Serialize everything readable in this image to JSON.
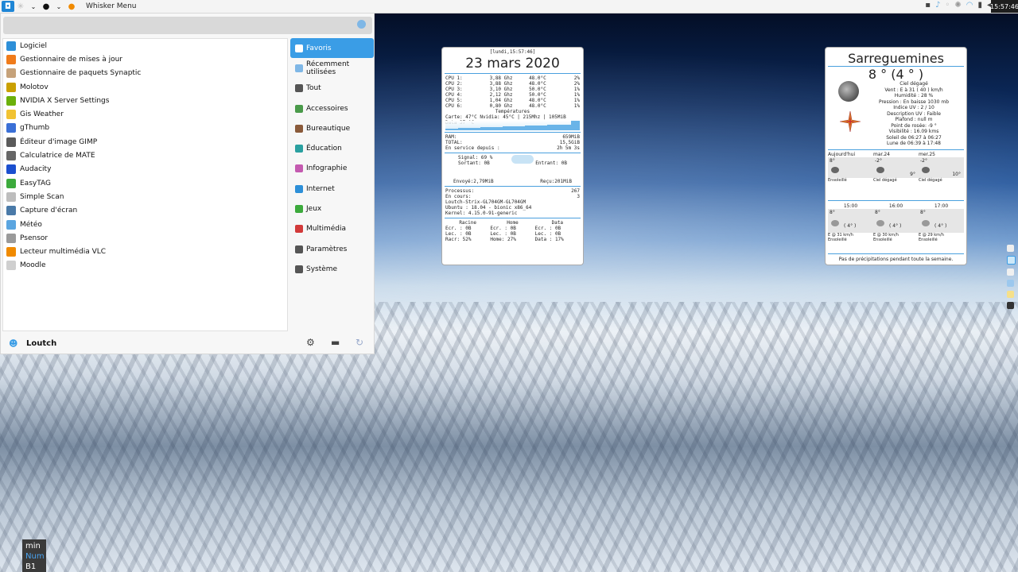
{
  "panel": {
    "menu_title": "Whisker Menu",
    "clock": "15:57:46"
  },
  "search": {
    "placeholder": ""
  },
  "apps": [
    {
      "label": "Logiciel",
      "color": "#2d8fd8"
    },
    {
      "label": "Gestionnaire de mises à jour",
      "color": "#f07b1a"
    },
    {
      "label": "Gestionnaire de paquets Synaptic",
      "color": "#c6a27a"
    },
    {
      "label": "Molotov",
      "color": "#caa000"
    },
    {
      "label": "NVIDIA X Server Settings",
      "color": "#6bb00a"
    },
    {
      "label": "Gis Weather",
      "color": "#f1c232"
    },
    {
      "label": "gThumb",
      "color": "#3a6fd6"
    },
    {
      "label": "Éditeur d'image GIMP",
      "color": "#5a5a5a"
    },
    {
      "label": "Calculatrice de MATE",
      "color": "#666666"
    },
    {
      "label": "Audacity",
      "color": "#1b4fcf"
    },
    {
      "label": "EasyTAG",
      "color": "#3caa3c"
    },
    {
      "label": "Simple Scan",
      "color": "#bdbdbd"
    },
    {
      "label": "Capture d'écran",
      "color": "#4a7aa8"
    },
    {
      "label": "Météo",
      "color": "#5aa5e0"
    },
    {
      "label": "Psensor",
      "color": "#9a9a9a"
    },
    {
      "label": "Lecteur multimédia VLC",
      "color": "#f08a00"
    },
    {
      "label": "Moodle",
      "color": "#cfcfcf"
    }
  ],
  "categories": [
    {
      "label": "Favoris",
      "active": true,
      "color": "#ffffff"
    },
    {
      "label": "Récemment utilisées",
      "active": false,
      "color": "#7fb7e6"
    },
    {
      "label": "Tout",
      "active": false,
      "color": "#555555"
    },
    {
      "label": "Accessoires",
      "active": false,
      "color": "#4a9a4a"
    },
    {
      "label": "Bureautique",
      "active": false,
      "color": "#8a5a3a"
    },
    {
      "label": "Éducation",
      "active": false,
      "color": "#2aa0a0"
    },
    {
      "label": "Infographie",
      "active": false,
      "color": "#c45ab0"
    },
    {
      "label": "Internet",
      "active": false,
      "color": "#2d8fd8"
    },
    {
      "label": "Jeux",
      "active": false,
      "color": "#3caa3c"
    },
    {
      "label": "Multimédia",
      "active": false,
      "color": "#d23a3a"
    },
    {
      "label": "Paramètres",
      "active": false,
      "color": "#555555"
    },
    {
      "label": "Système",
      "active": false,
      "color": "#555555"
    }
  ],
  "user": {
    "name": "Loutch"
  },
  "sysmon": {
    "timestamp": "[lundi,15:57:46]",
    "date": "23 mars 2020",
    "cpus": [
      {
        "name": "CPU 1:",
        "freq": "3,88 Ghz",
        "temp": "48.0°C",
        "load": "2%"
      },
      {
        "name": "CPU 2:",
        "freq": "3,88 Ghz",
        "temp": "48.0°C",
        "load": "2%"
      },
      {
        "name": "CPU 3:",
        "freq": "3,10 Ghz",
        "temp": "50.0°C",
        "load": "1%"
      },
      {
        "name": "CPU 4:",
        "freq": "2,12 Ghz",
        "temp": "50.0°C",
        "load": "1%"
      },
      {
        "name": "CPU 5:",
        "freq": "1,04 Ghz",
        "temp": "48.0°C",
        "load": "1%"
      },
      {
        "name": "CPU 6:",
        "freq": "0,80 Ghz",
        "temp": "48.0°C",
        "load": "1%"
      }
    ],
    "temps_title": "Températures",
    "temps_line": "Carte: 47°C  Nvidia: 45°C | 215Mhz  |  105MiB Data  37 °C",
    "ram_label": "RAM:",
    "ram_value": "659MiB",
    "total_label": "TOTAL:",
    "total_value": "15,5GiB",
    "uptime_label": "En service depuis :",
    "uptime_value": "2h 5m 3s",
    "signal": "Signal: 69 %",
    "out_label": "Sortant: 0B",
    "in_label": "Entrant: 0B",
    "sent": "Envoyé:2,79MiB",
    "received": "Reçu:201MiB",
    "processes_label": "Processus:",
    "processes_value": "267",
    "running_label": "En cours:",
    "running_value": "3",
    "host": "Loutch-Strix-GL704GM-GL704GM",
    "os": "Ubuntu : 18.04 - bionic  x86_64",
    "kernel": "Kernel: 4.15.0-91-generic",
    "disks": [
      {
        "name": "Racine",
        "ecr": "Ecr. : 0B",
        "lec": "Lec. : 0B",
        "usage": "Racr: 52%"
      },
      {
        "name": "Home",
        "ecr": "Ecr. : 0B",
        "lec": "Lec. : 0B",
        "usage": "Home: 27%"
      },
      {
        "name": "Data",
        "ecr": "Ecr. : 0B",
        "lec": "Lec. : 0B",
        "usage": "Data : 17%"
      }
    ]
  },
  "weather": {
    "city": "Sarreguemines",
    "temp": "8 °  (4 ° )",
    "details": [
      "Ciel dégagé",
      "Vent : E à 31 ( 40 ) km/h",
      "Humidité : 28 %",
      "Pression : En baisse  1030 mb",
      "Indice UV : 2 / 10",
      "Description UV : Faible",
      "Plafond : null m",
      "Point de rosée: -9 °",
      "Visibilité : 16.09 kms",
      "Soleil de 06:27 à 06:27",
      "Lune de 06:39 à 17:48"
    ],
    "days": [
      {
        "name": "Aujourd'hui",
        "hi": "8°",
        "lo": "",
        "desc": "Ensoleillé"
      },
      {
        "name": "mar.24",
        "hi": "-2°",
        "lo": "9°",
        "desc": "Ciel dégagé"
      },
      {
        "name": "mer.25",
        "hi": "-2°",
        "lo": "10°",
        "desc": "Ciel dégagé"
      }
    ],
    "hours": [
      {
        "time": "15:00",
        "temp": "8°",
        "feel": "( 4° )",
        "wind": "E @ 31 km/h",
        "desc": "Ensoleillé"
      },
      {
        "time": "16:00",
        "temp": "8°",
        "feel": "( 4° )",
        "wind": "E @ 30 km/h",
        "desc": "Ensoleillé"
      },
      {
        "time": "17:00",
        "temp": "8°",
        "feel": "( 4° )",
        "wind": "E @ 29 km/h",
        "desc": "Ensoleillé"
      }
    ],
    "footer": "Pas de précipitations pendant toute la semaine."
  },
  "keys": {
    "min": "min",
    "num": "Num",
    "b1": "B1"
  }
}
